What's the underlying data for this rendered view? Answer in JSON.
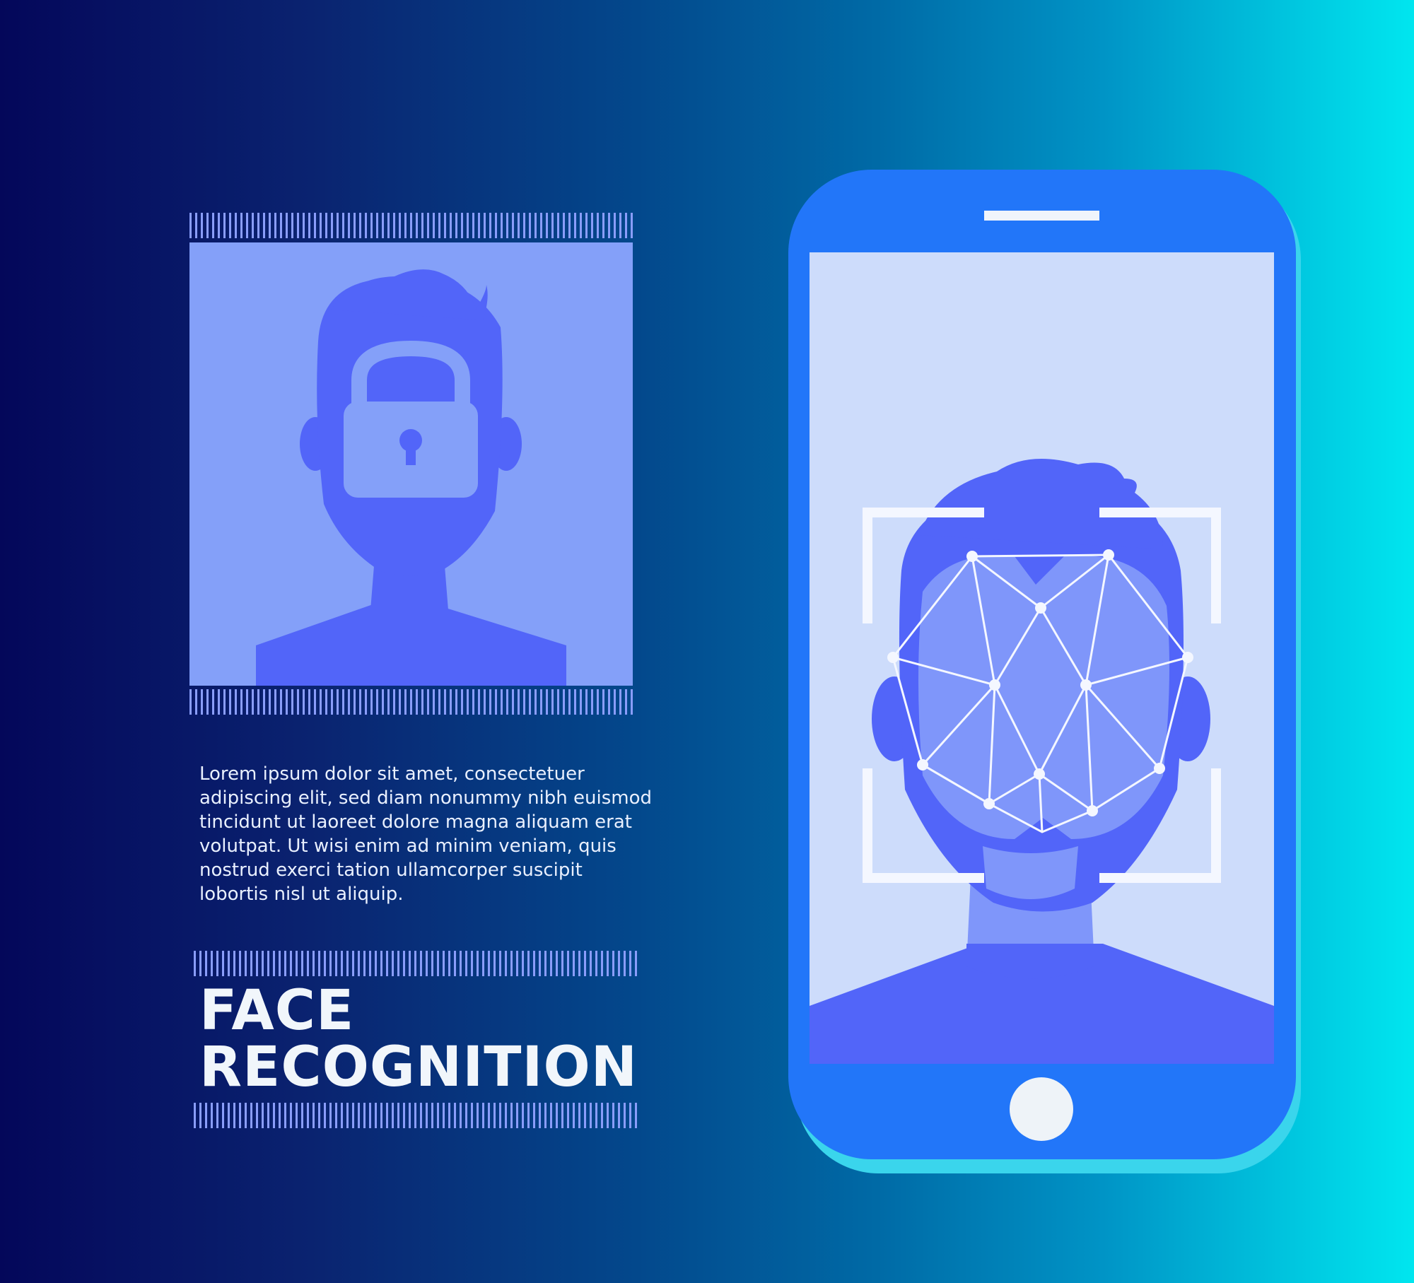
{
  "panel": {
    "body_text": "Lorem ipsum dolor sit amet, consectetuer adipiscing elit, sed diam nonummy nibh euismod tincidunt ut laoreet dolore magna aliquam erat volutpat. Ut wisi enim ad minim veniam, quis nostrud exerci tation ullamcorper suscipit lobortis nisl ut aliquip.",
    "title_line1": "FACE",
    "title_line2": "RECOGNITION"
  },
  "icons": {
    "profile_photo": "locked-avatar-icon",
    "lock": "padlock-icon",
    "phone_screen_face": "face-scan-mesh-icon",
    "home_button": "home-button-icon"
  },
  "colors": {
    "background_start": "#04075a",
    "background_end": "#00e6ef",
    "phone_body": "#2276f9",
    "phone_screen": "#cddcfb",
    "avatar": "#5265f9",
    "photo_background": "#84a0f9",
    "text": "#e9f0ff",
    "scan_lines": "#f4f7ff"
  }
}
